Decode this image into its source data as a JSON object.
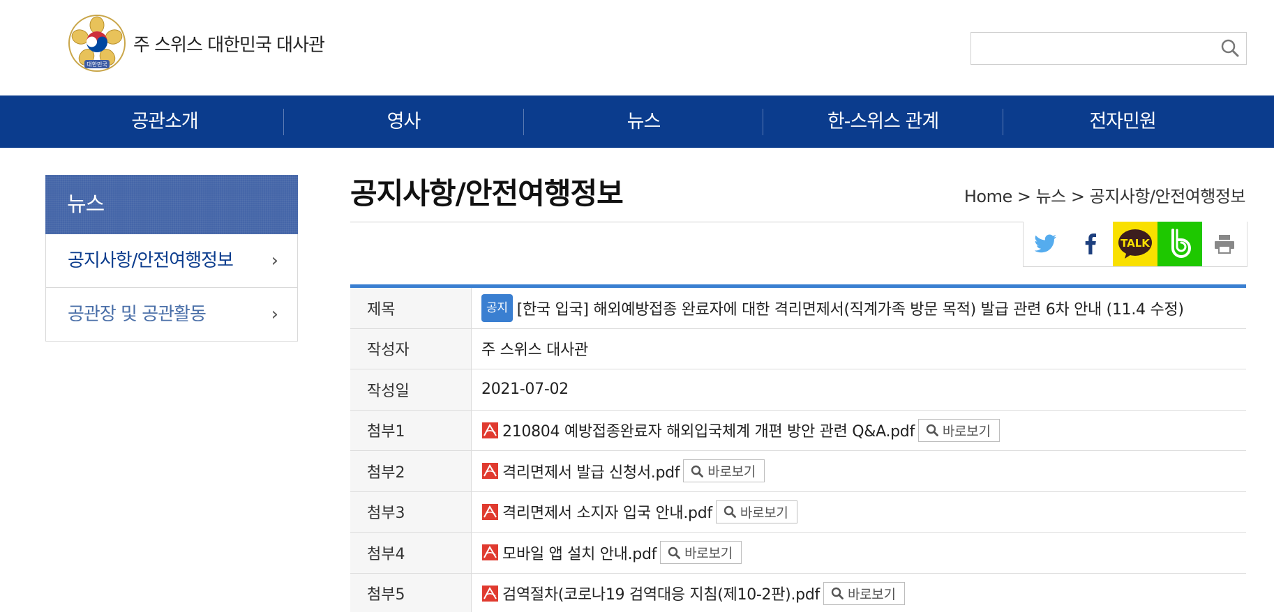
{
  "header": {
    "site_title": "주 스위스 대한민국 대사관",
    "emblem_text": "대한민국",
    "search": {
      "placeholder": "",
      "value": ""
    }
  },
  "nav": {
    "items": [
      {
        "label": "공관소개"
      },
      {
        "label": "영사"
      },
      {
        "label": "뉴스"
      },
      {
        "label": "한-스위스 관계"
      },
      {
        "label": "전자민원"
      }
    ]
  },
  "sidebar": {
    "title": "뉴스",
    "items": [
      {
        "label": "공지사항/안전여행정보",
        "arrow": "›"
      },
      {
        "label": "공관장 및 공관활동",
        "arrow": "›"
      }
    ]
  },
  "page": {
    "title": "공지사항/안전여행정보",
    "breadcrumb": "Home > 뉴스 > 공지사항/안전여행정보"
  },
  "share": {
    "icons": [
      "twitter-icon",
      "facebook-icon",
      "kakaotalk-icon",
      "band-icon",
      "print-icon"
    ],
    "kakao_text": "TALK"
  },
  "colors": {
    "nav_bg": "#0b3c8d",
    "sidebar_title_bg": "#4566a8",
    "board_accent": "#3a7fd1",
    "kakao": "#f9e000",
    "band": "#1ec800"
  },
  "board": {
    "subject_label": "제목",
    "notice_badge": "공지",
    "subject": "[한국 입국] 해외예방접종 완료자에 대한 격리면제서(직계가족 방문 목적) 발급 관련 6차 안내 (11.4 수정)",
    "author_label": "작성자",
    "author": "주 스위스 대사관",
    "date_label": "작성일",
    "date": "2021-07-02",
    "view_label": "바로보기",
    "attachments": [
      {
        "label": "첨부1",
        "file": "210804 예방접종완료자 해외입국체계 개편 방안 관련 Q&A.pdf"
      },
      {
        "label": "첨부2",
        "file": "격리면제서 발급 신청서.pdf"
      },
      {
        "label": "첨부3",
        "file": "격리면제서 소지자 입국 안내.pdf"
      },
      {
        "label": "첨부4",
        "file": "모바일 앱 설치 안내.pdf"
      },
      {
        "label": "첨부5",
        "file": "검역절차(코로나19 검역대응 지침(제10-2판).pdf"
      }
    ]
  }
}
